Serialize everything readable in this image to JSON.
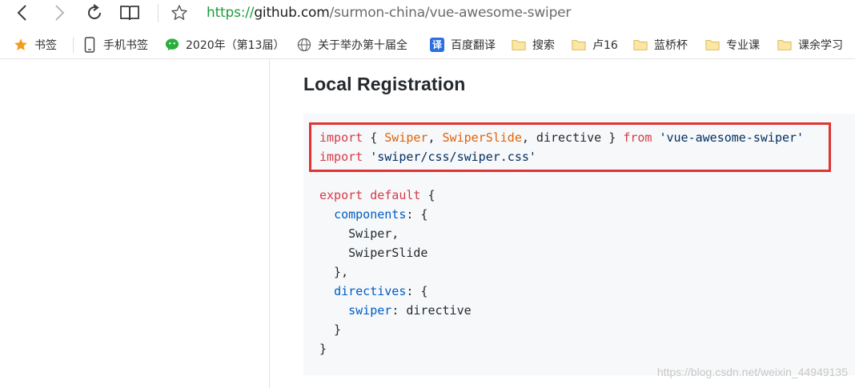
{
  "browser": {
    "url": {
      "scheme": "https://",
      "host": "github.com",
      "path": "/surmon-china/vue-awesome-swiper"
    }
  },
  "bookmarks": [
    {
      "icon": "star-icon",
      "label": "书签"
    },
    {
      "icon": "phone-icon",
      "label": "手机书签"
    },
    {
      "icon": "wechat-icon",
      "label": "2020年（第13届）"
    },
    {
      "icon": "globe-icon",
      "label": "关于举办第十届全"
    },
    {
      "icon": "translate-icon",
      "label": "百度翻译",
      "icon_text": "译"
    },
    {
      "icon": "folder-icon",
      "label": "搜索"
    },
    {
      "icon": "folder-icon",
      "label": "卢16"
    },
    {
      "icon": "folder-icon",
      "label": "蓝桥杯"
    },
    {
      "icon": "folder-icon",
      "label": "专业课"
    },
    {
      "icon": "folder-icon",
      "label": "课余学习"
    }
  ],
  "section": {
    "title": "Local Registration"
  },
  "code": {
    "line1": {
      "kw_import": "import",
      "brace_open": " { ",
      "swiper": "Swiper",
      "comma1": ", ",
      "swiper_slide": "SwiperSlide",
      "rest": ", directive } ",
      "kw_from": "from",
      "space": " ",
      "module": "'vue-awesome-swiper'"
    },
    "line2": {
      "kw_import": "import",
      "space": " ",
      "css_path": "'swiper/css/swiper.css'"
    },
    "line4": {
      "kw_export": "export",
      "space": " ",
      "kw_default": "default",
      "brace": " {"
    },
    "line5": {
      "indent": "  ",
      "prop": "components",
      "rest": ": {"
    },
    "line6": {
      "text": "    Swiper,"
    },
    "line7": {
      "text": "    SwiperSlide"
    },
    "line8": {
      "text": "  },"
    },
    "line9": {
      "indent": "  ",
      "prop": "directives",
      "rest": ": {"
    },
    "line10": {
      "indent": "    ",
      "prop": "swiper",
      "rest": ": directive"
    },
    "line11": {
      "text": "  }"
    },
    "line12": {
      "text": "}"
    }
  },
  "watermark": "https://blog.csdn.net/weixin_44949135",
  "colors": {
    "url_scheme": "#1a9c3c",
    "highlight_border": "#e03434",
    "code_keyword": "#d73a49",
    "code_string": "#032f62",
    "code_import_name": "#e36209",
    "code_property": "#005cc5"
  }
}
